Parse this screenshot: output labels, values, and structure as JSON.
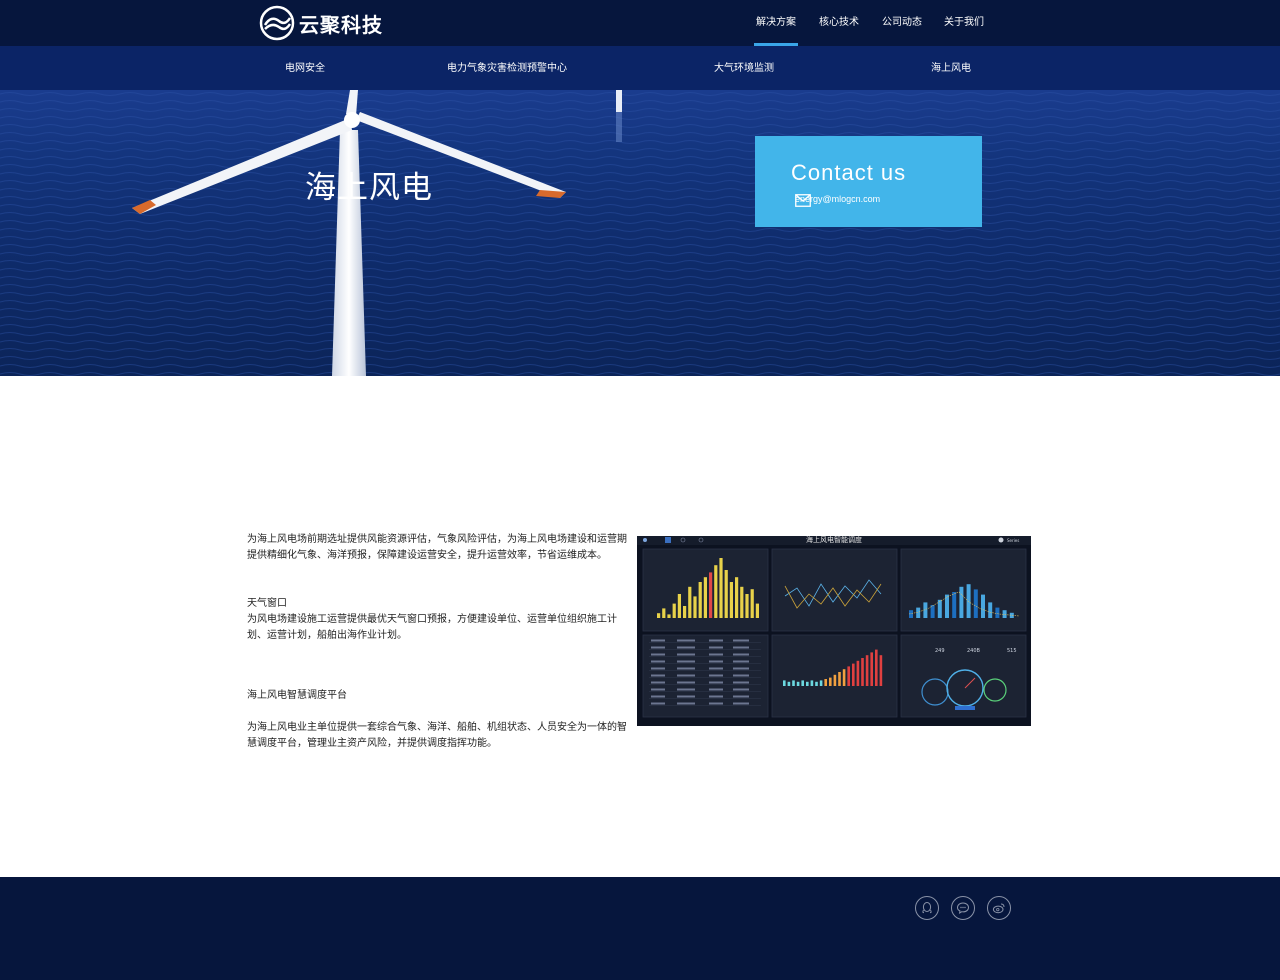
{
  "header": {
    "logo_text": "云聚科技",
    "nav": [
      {
        "label": "解决方案",
        "active": true
      },
      {
        "label": "核心技术",
        "active": false
      },
      {
        "label": "公司动态",
        "active": false
      },
      {
        "label": "关于我们",
        "active": false
      }
    ],
    "accent_color": "#3aa6e8"
  },
  "subnav": [
    {
      "label": "电网安全"
    },
    {
      "label": "电力气象灾害检测预警中心"
    },
    {
      "label": "大气环境监测"
    },
    {
      "label": "海上风电"
    }
  ],
  "hero": {
    "title": "海上风电",
    "contact": {
      "title": "Contact us",
      "email": "energy@mlogcn.com",
      "icon": "mail-icon",
      "color": "#42b5ea"
    }
  },
  "content": {
    "intro": "为海上风电场前期选址提供风能资源评估，气象风险评估，为海上风电场建设和运营期提供精细化气象、海洋预报，保障建设运营安全，提升运营效率，节省运维成本。",
    "weather_window_title": "天气窗口",
    "weather_window_text": "为风电场建设施工运营提供最优天气窗口预报，方便建设单位、运营单位组织施工计划、运营计划，船舶出海作业计划。",
    "platform_title": "海上风电智慧调度平台",
    "platform_text": "为海上风电业主单位提供一套综合气象、海洋、船舶、机组状态、人员安全为一体的智慧调度平台，管理业主资产风险，并提供调度指挥功能。",
    "dashboard": {
      "title": "海上风电智能调度",
      "user": "Series",
      "gauge_values": [
        "249",
        "240B",
        "515"
      ]
    }
  },
  "footer": {
    "icons": [
      "qq-icon",
      "wechat-icon",
      "weibo-icon"
    ]
  }
}
